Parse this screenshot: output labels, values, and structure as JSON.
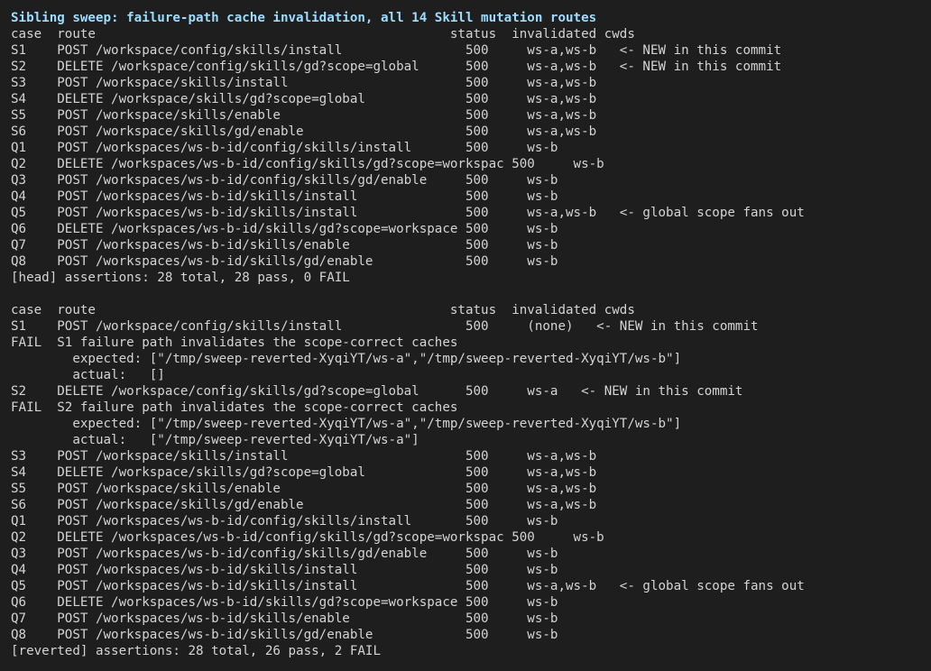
{
  "terminal": {
    "title": "Sibling sweep: failure-path cache invalidation, all 14 Skill mutation routes",
    "lines": [
      "case  route                                              status  invalidated cwds",
      "S1    POST /workspace/config/skills/install                500     ws-a,ws-b   <- NEW in this commit",
      "S2    DELETE /workspace/config/skills/gd?scope=global      500     ws-a,ws-b   <- NEW in this commit",
      "S3    POST /workspace/skills/install                       500     ws-a,ws-b",
      "S4    DELETE /workspace/skills/gd?scope=global             500     ws-a,ws-b",
      "S5    POST /workspace/skills/enable                        500     ws-a,ws-b",
      "S6    POST /workspace/skills/gd/enable                     500     ws-a,ws-b",
      "Q1    POST /workspaces/ws-b-id/config/skills/install       500     ws-b",
      "Q2    DELETE /workspaces/ws-b-id/config/skills/gd?scope=workspac 500     ws-b",
      "Q3    POST /workspaces/ws-b-id/config/skills/gd/enable     500     ws-b",
      "Q4    POST /workspaces/ws-b-id/skills/install              500     ws-b",
      "Q5    POST /workspaces/ws-b-id/skills/install              500     ws-a,ws-b   <- global scope fans out",
      "Q6    DELETE /workspaces/ws-b-id/skills/gd?scope=workspace 500     ws-b",
      "Q7    POST /workspaces/ws-b-id/skills/enable               500     ws-b",
      "Q8    POST /workspaces/ws-b-id/skills/gd/enable            500     ws-b",
      "[head] assertions: 28 total, 28 pass, 0 FAIL",
      "",
      "case  route                                              status  invalidated cwds",
      "S1    POST /workspace/config/skills/install                500     (none)   <- NEW in this commit",
      "FAIL  S1 failure path invalidates the scope-correct caches",
      "        expected: [\"/tmp/sweep-reverted-XyqiYT/ws-a\",\"/tmp/sweep-reverted-XyqiYT/ws-b\"]",
      "        actual:   []",
      "S2    DELETE /workspace/config/skills/gd?scope=global      500     ws-a   <- NEW in this commit",
      "FAIL  S2 failure path invalidates the scope-correct caches",
      "        expected: [\"/tmp/sweep-reverted-XyqiYT/ws-a\",\"/tmp/sweep-reverted-XyqiYT/ws-b\"]",
      "        actual:   [\"/tmp/sweep-reverted-XyqiYT/ws-a\"]",
      "S3    POST /workspace/skills/install                       500     ws-a,ws-b",
      "S4    DELETE /workspace/skills/gd?scope=global             500     ws-a,ws-b",
      "S5    POST /workspace/skills/enable                        500     ws-a,ws-b",
      "S6    POST /workspace/skills/gd/enable                     500     ws-a,ws-b",
      "Q1    POST /workspaces/ws-b-id/config/skills/install       500     ws-b",
      "Q2    DELETE /workspaces/ws-b-id/config/skills/gd?scope=workspac 500     ws-b",
      "Q3    POST /workspaces/ws-b-id/config/skills/gd/enable     500     ws-b",
      "Q4    POST /workspaces/ws-b-id/skills/install              500     ws-b",
      "Q5    POST /workspaces/ws-b-id/skills/install              500     ws-a,ws-b   <- global scope fans out",
      "Q6    DELETE /workspaces/ws-b-id/skills/gd?scope=workspace 500     ws-b",
      "Q7    POST /workspaces/ws-b-id/skills/enable               500     ws-b",
      "Q8    POST /workspaces/ws-b-id/skills/gd/enable            500     ws-b",
      "[reverted] assertions: 28 total, 26 pass, 2 FAIL"
    ]
  },
  "colors": {
    "background": "#1e1e1e",
    "text": "#d4d4d4",
    "title": "#9cdcfe"
  }
}
